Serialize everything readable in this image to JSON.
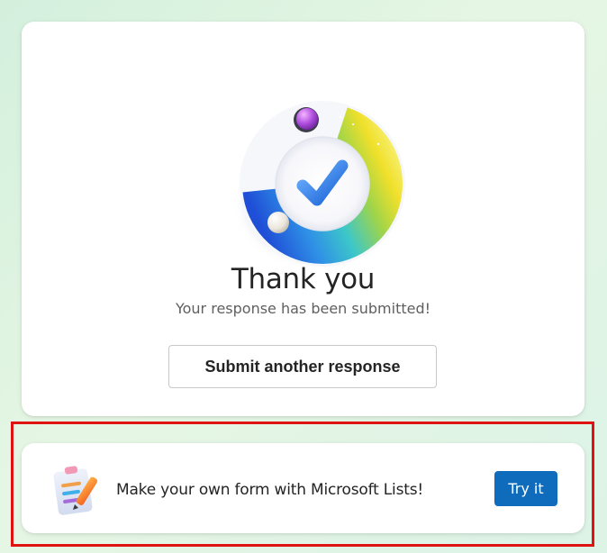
{
  "confirmation": {
    "title": "Thank you",
    "subtitle": "Your response has been submitted!",
    "submit_another_label": "Submit another response",
    "illustration_icon": "checkmark-ring-icon"
  },
  "promo": {
    "text": "Make your own form with Microsoft Lists!",
    "button_label": "Try it",
    "icon": "lists-form-icon"
  },
  "colors": {
    "primary_button": "#0f6cbd",
    "highlight_border": "#e01313",
    "background": "#d9f2e2"
  }
}
